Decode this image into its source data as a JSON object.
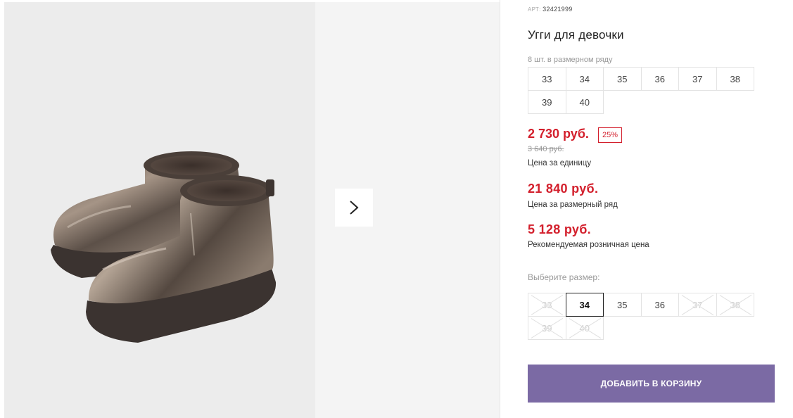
{
  "product": {
    "art_label": "АРТ:",
    "art_number": "32421999",
    "title": "Угги для девочки"
  },
  "size_row": {
    "caption": "8 шт. в размерном ряду",
    "sizes": [
      "33",
      "34",
      "35",
      "36",
      "37",
      "38",
      "39",
      "40"
    ]
  },
  "prices": {
    "current": "2 730 руб.",
    "discount": "25%",
    "old": "3 640 руб.",
    "unit_label": "Цена за единицу",
    "row_total": "21 840 руб.",
    "row_label": "Цена за размерный ряд",
    "retail": "5 128 руб.",
    "retail_label": "Рекомендуемая розничная цена"
  },
  "size_picker": {
    "caption": "Выберите размер:",
    "options": [
      {
        "size": "33",
        "state": "disabled"
      },
      {
        "size": "34",
        "state": "selected"
      },
      {
        "size": "35",
        "state": "available"
      },
      {
        "size": "36",
        "state": "available"
      },
      {
        "size": "37",
        "state": "disabled"
      },
      {
        "size": "38",
        "state": "disabled"
      },
      {
        "size": "39",
        "state": "disabled"
      },
      {
        "size": "40",
        "state": "disabled"
      }
    ]
  },
  "cart": {
    "add_label": "ДОБАВИТЬ В КОРЗИНУ"
  },
  "gallery": {
    "next_icon": "chevron-right-icon"
  },
  "colors": {
    "price_red": "#d31f2c",
    "button_purple": "#7b6aa4"
  }
}
